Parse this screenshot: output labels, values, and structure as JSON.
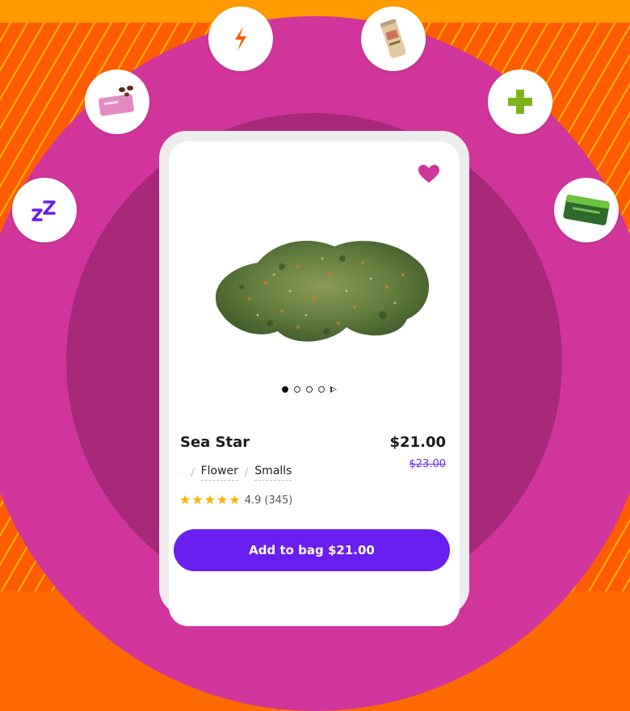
{
  "colors": {
    "accent": "#6a1ef0",
    "background_orange": "#ff5c00",
    "arc_pink": "#d1359b",
    "arc_inner": "#a8287c",
    "heart": "#d1359b",
    "star": "#f5b400",
    "old_price": "#6a2ee8"
  },
  "categories": [
    {
      "name": "sleep-icon"
    },
    {
      "name": "edible-icon"
    },
    {
      "name": "energy-icon"
    },
    {
      "name": "drink-icon"
    },
    {
      "name": "health-icon"
    },
    {
      "name": "tin-icon"
    }
  ],
  "product": {
    "name": "Sea Star",
    "price": "$21.00",
    "old_price": "$23.00",
    "breadcrumb": [
      "Flower",
      "Smalls"
    ],
    "rating": "4.9",
    "review_count": "(345)",
    "stars": 5,
    "image_count": 4,
    "active_image": 1
  },
  "cta": {
    "label": "Add to bag $21.00"
  }
}
